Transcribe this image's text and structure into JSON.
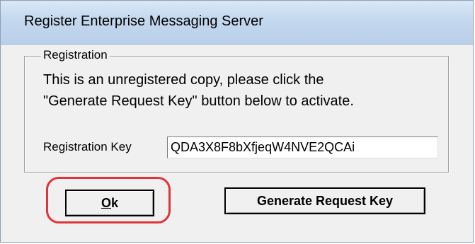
{
  "window": {
    "title": "Register Enterprise Messaging Server"
  },
  "registration": {
    "group_label": "Registration",
    "message_line1": "This is an unregistered copy, please click the",
    "message_line2": "\"Generate Request Key\"  button below to activate.",
    "key_label": "Registration Key",
    "key_value": "QDA3X8F8bXfjeqW4NVE2QCAi"
  },
  "buttons": {
    "ok_accel": "O",
    "ok_rest": "k",
    "generate_label": "Generate Request Key"
  },
  "colors": {
    "highlight_ring": "#e0343a",
    "titlebar": "#c5d9ee",
    "dialog_bg": "#f0f0f0"
  }
}
